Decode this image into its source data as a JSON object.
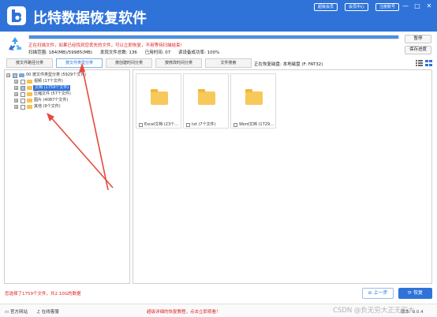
{
  "app": {
    "title": "比特数据恢复软件"
  },
  "top_buttons": [
    "超级会员",
    "会员中心",
    "注册账号"
  ],
  "window_controls": {
    "minimize": "—",
    "maximize": "□",
    "close": "✕"
  },
  "scan": {
    "progress": 1.0,
    "message": "正在扫描文件，如果已经找到您丢失的文件，可以立即恢复，不用等待扫描结束!",
    "range": "扫描范围: 184(MB)/59985(MB)",
    "found": "发现文件总数: 136",
    "elapsed": "已用时间: 07",
    "integrity": "读设备成功率: 100%"
  },
  "side_buttons": {
    "pause": "暂停",
    "save": "保存进度"
  },
  "tabs": [
    "按文件路径分类",
    "按文件类型分类",
    "按创建时间分类",
    "按修改时间分类",
    "文件搜索"
  ],
  "active_tab": 1,
  "current_disk": "正在恢复磁盘: 本地磁盘 (F: FAT32)",
  "tree": [
    {
      "label": "00 按文件类型分类  (5929个文件)",
      "level": 0,
      "expander": "⊟",
      "partial": true,
      "selected": false
    },
    {
      "label": "视频  (17个文件)",
      "level": 1,
      "expander": "⊞",
      "partial": false,
      "selected": false
    },
    {
      "label": "文档  (1759个文件)",
      "level": 1,
      "expander": "⊞",
      "partial": true,
      "selected": true
    },
    {
      "label": "压缩文件  (57个文件)",
      "level": 1,
      "expander": "⊞",
      "partial": false,
      "selected": false
    },
    {
      "label": "图片  (4087个文件)",
      "level": 1,
      "expander": "⊞",
      "partial": false,
      "selected": false
    },
    {
      "label": "其他  (9个文件)",
      "level": 1,
      "expander": "⊞",
      "partial": false,
      "selected": false
    }
  ],
  "files": [
    {
      "label": "Excel文档 (23个..."
    },
    {
      "label": "txt (7个文件)"
    },
    {
      "label": "Word文档 (1729..."
    }
  ],
  "bottom": {
    "status": "您选择了1759个文件，共2.10G的数据",
    "prev": "上一步",
    "recover": "恢复"
  },
  "footer": {
    "website": "官方网站",
    "support": "在线客服",
    "promo": "超级详细的恢复教程，点击立即观看！",
    "version": "版本: 9.0.4"
  },
  "watermark": "CSDN @负无穷大正无穷大",
  "colors": {
    "brand": "#2f73d9",
    "alert": "#e02020",
    "folder": "#f7c95a",
    "arrow": "#e64a3c"
  },
  "icons": {
    "logo": "app-logo-icon",
    "recycle": "recycle-icon",
    "list_view": "list-view-icon",
    "grid_view": "grid-view-icon",
    "folder": "folder-icon",
    "website": "monitor-icon",
    "support": "headset-icon",
    "prev": "arrow-left-icon",
    "recover": "restore-icon"
  }
}
